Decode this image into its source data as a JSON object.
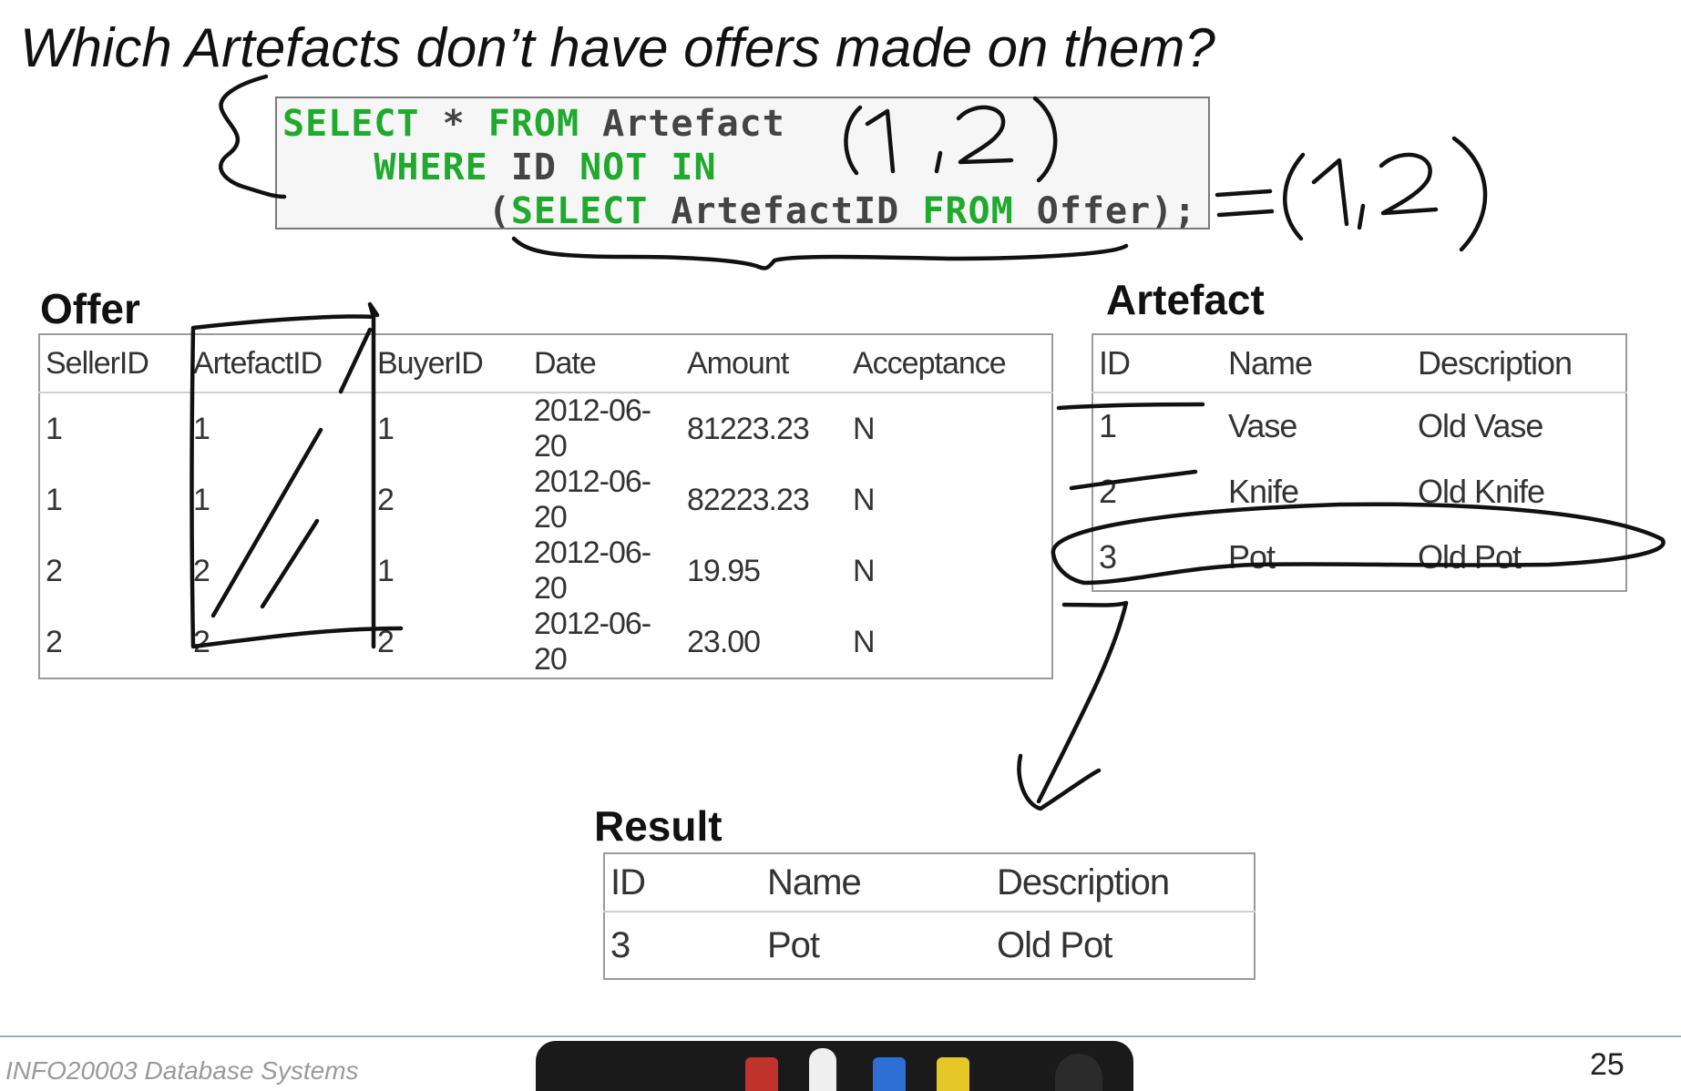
{
  "slide": {
    "title": "Which Artefacts don’t have offers made on them?",
    "sql": {
      "line1_kw1": "SELECT",
      "line1_mid": " * ",
      "line1_kw2": "FROM",
      "line1_tail": " Artefact",
      "line2_kw1": "WHERE",
      "line2_mid": " ID ",
      "line2_kw2": "NOT IN",
      "line3_open": "(",
      "line3_kw1": "SELECT",
      "line3_mid": " ArtefactID ",
      "line3_kw2": "FROM",
      "line3_tail": " Offer);"
    },
    "offer": {
      "label": "Offer",
      "columns": [
        "SellerID",
        "ArtefactID",
        "BuyerID",
        "Date",
        "Amount",
        "Acceptance"
      ],
      "rows": [
        [
          "1",
          "1",
          "1",
          "2012-06-20",
          "81223.23",
          "N"
        ],
        [
          "1",
          "1",
          "2",
          "2012-06-20",
          "82223.23",
          "N"
        ],
        [
          "2",
          "2",
          "1",
          "2012-06-20",
          "19.95",
          "N"
        ],
        [
          "2",
          "2",
          "2",
          "2012-06-20",
          "23.00",
          "N"
        ]
      ]
    },
    "artefact": {
      "label": "Artefact",
      "columns": [
        "ID",
        "Name",
        "Description"
      ],
      "rows": [
        [
          "1",
          "Vase",
          "Old Vase"
        ],
        [
          "2",
          "Knife",
          "Old Knife"
        ],
        [
          "3",
          "Pot",
          "Old Pot"
        ]
      ]
    },
    "result": {
      "label": "Result",
      "columns": [
        "ID",
        "Name",
        "Description"
      ],
      "rows": [
        [
          "3",
          "Pot",
          "Old Pot"
        ]
      ]
    },
    "annotations": {
      "in_query": "(1,2)",
      "equals": "=(1,2)"
    },
    "footer": {
      "course": "INFO20003 Database Systems",
      "page": "25"
    }
  }
}
